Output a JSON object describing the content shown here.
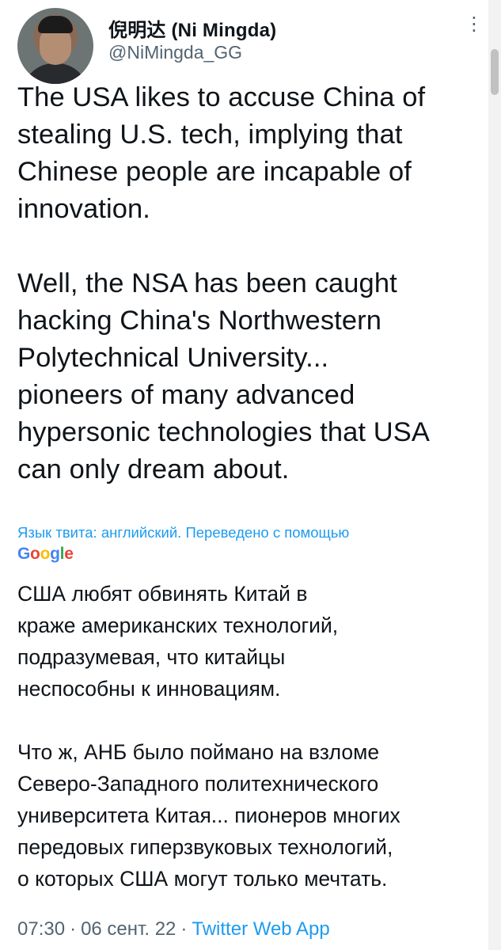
{
  "author": {
    "display_name": "倪明达 (Ni Mingda)",
    "handle": "@NiMingda_GG",
    "avatar_icon": "person-avatar"
  },
  "menu": {
    "more_icon": "more-vertical-icon"
  },
  "tweet": {
    "text": "The USA likes to accuse China of\nstealing U.S. tech, implying that\nChinese people are incapable of\ninnovation.\n\nWell, the NSA has been caught\nhacking China's Northwestern\nPolytechnical University...\npioneers of many advanced\nhypersonic technologies that USA\ncan only dream about."
  },
  "translation": {
    "label": "Язык твита: английский. Переведено с помощью",
    "provider_logo": "Google",
    "text": "США любят обвинять Китай в\nкраже американских технологий,\nподразумевая, что китайцы\nнеспособны к инновациям.\n\nЧто ж, АНБ было поймано на взломе\nСеверо-Западного политехнического\nуниверситета Китая... пионеров многих\nпередовых гиперзвуковых технологий,\nо которых США могут только мечтать."
  },
  "meta": {
    "time": "07:30",
    "separator": "·",
    "date": "06 сент. 22",
    "source": "Twitter Web App"
  },
  "colors": {
    "link": "#1d9bf0",
    "secondary_text": "#536471",
    "primary_text": "#0f1419"
  }
}
